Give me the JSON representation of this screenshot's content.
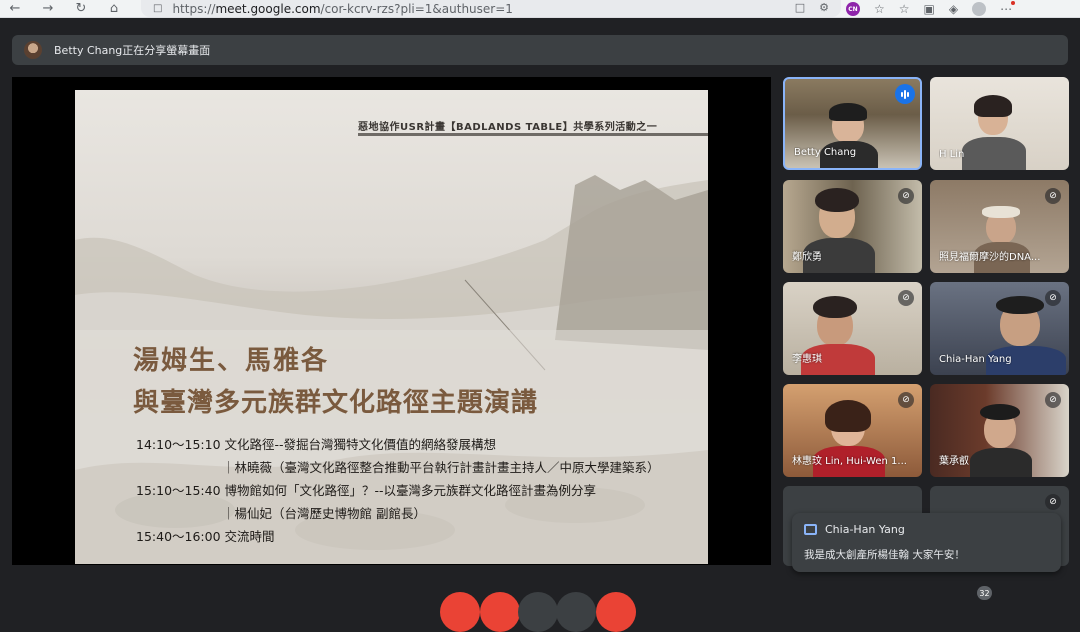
{
  "browser": {
    "url_prefix": "https://",
    "url_host": "meet.google.com",
    "url_path": "/cor-kcrv-rzs?pli=1&authuser=1",
    "profile_initials": "CN"
  },
  "banner": {
    "text": "Betty Chang正在分享螢幕畫面"
  },
  "slide": {
    "header": "惡地協作USR計畫【BADLANDS TABLE】共學系列活動之一",
    "title_line1": "湯姆生、馬雅各",
    "title_line2": "與臺灣多元族群文化路徑主題演講",
    "agenda": [
      "14:10～15:10  文化路徑--發掘台灣獨特文化價值的網絡發展構想",
      "｜林曉薇（臺灣文化路徑整合推動平台執行計畫計畫主持人／中原大學建築系）",
      "15:10～15:40  博物館如何「文化路徑」？--以臺灣多元族群文化路徑計畫為例分享",
      "｜楊仙妃（台灣歷史博物館  副館長）",
      "15:40～16:00  交流時間"
    ]
  },
  "participants": [
    {
      "name": "Betty Chang"
    },
    {
      "name": "H Lin"
    },
    {
      "name": "鄭欣勇"
    },
    {
      "name": "照見福爾摩沙的DNA..."
    },
    {
      "name": "李惠琪"
    },
    {
      "name": "Chia-Han Yang"
    },
    {
      "name": "林惠玟 Lin, Hui-Wen 1..."
    },
    {
      "name": "葉承叡"
    }
  ],
  "chat": {
    "sender": "Chia-Han Yang",
    "message": "我是成大創產所楊佳翰  大家午安！"
  },
  "controls": {
    "people_count": "32"
  },
  "colors": {
    "meet_bg": "#202124",
    "tile_bg": "#3c4043",
    "active_border": "#8ab4f8",
    "speaking_badge": "#1a73e8",
    "slide_title": "#7a5a3e"
  }
}
